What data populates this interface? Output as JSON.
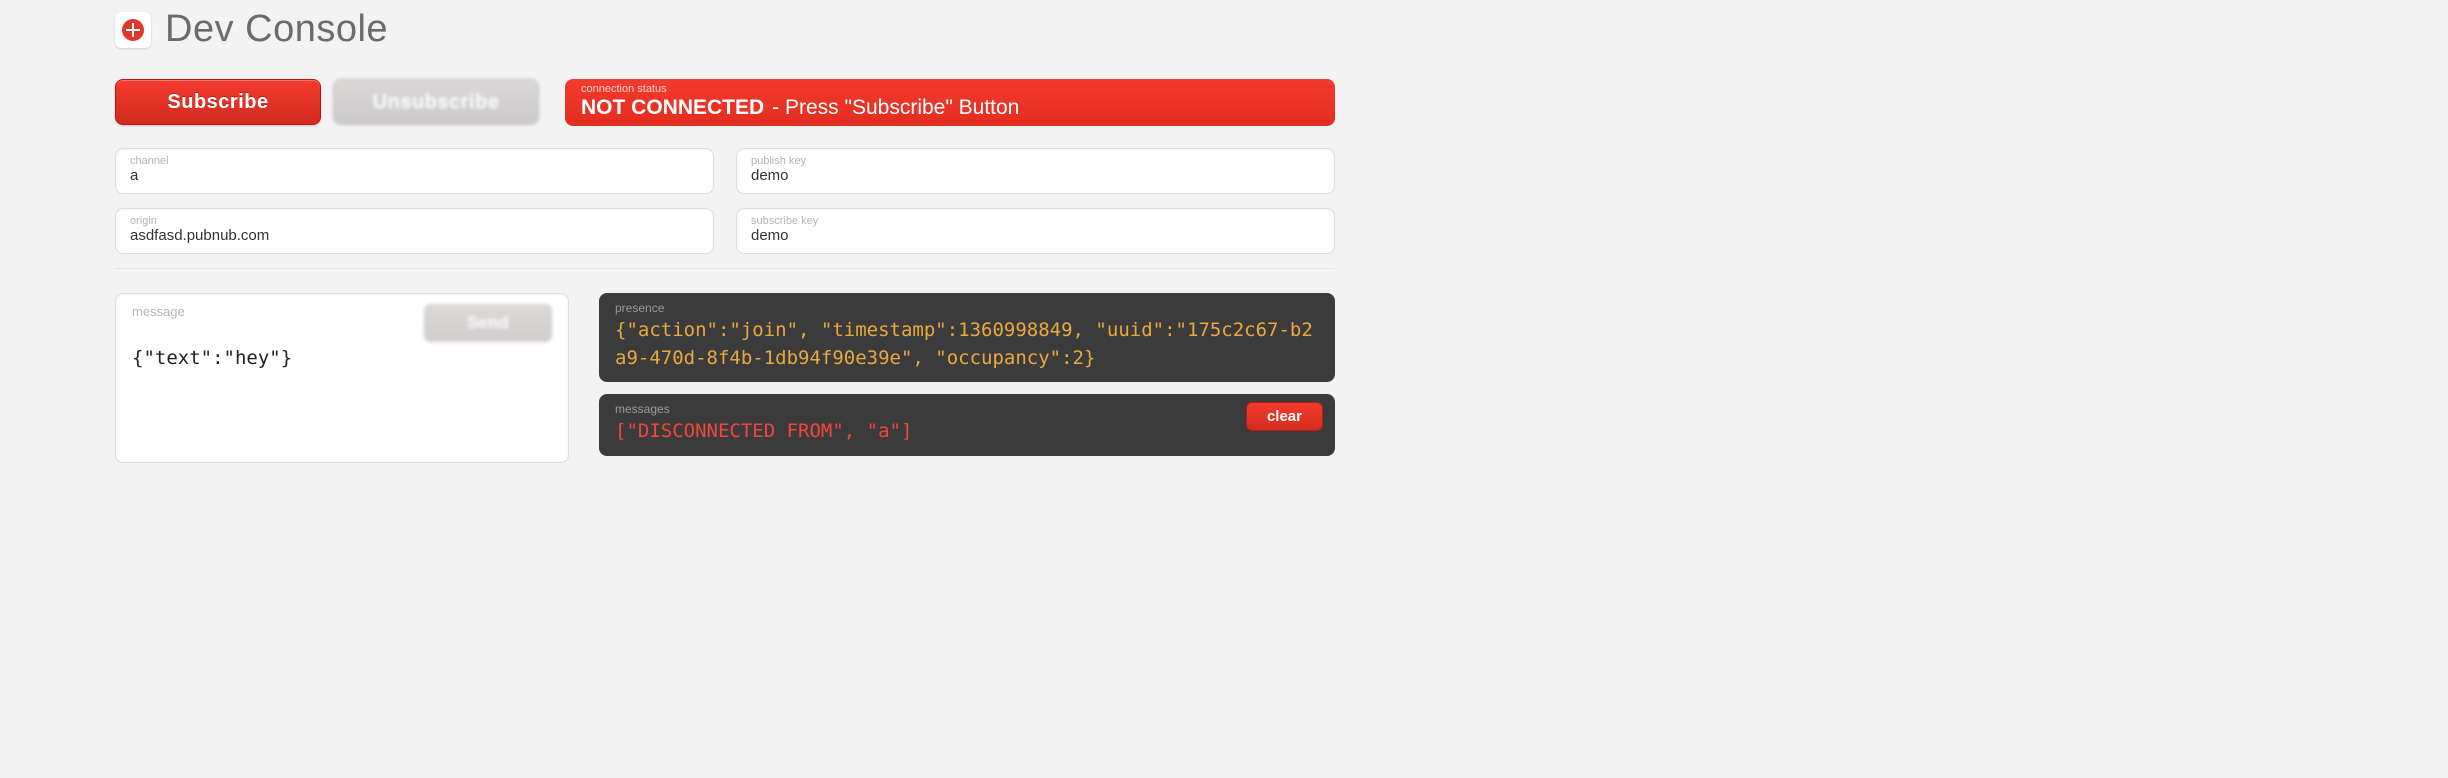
{
  "header": {
    "title": "Dev Console"
  },
  "buttons": {
    "subscribe": "Subscribe",
    "unsubscribe": "Unsubscribe",
    "send": "Send",
    "clear": "clear"
  },
  "status": {
    "label": "connection status",
    "main": "NOT CONNECTED",
    "sub": "- Press \"Subscribe\" Button"
  },
  "inputs": {
    "channel": {
      "label": "channel",
      "value": "a"
    },
    "publish_key": {
      "label": "publish key",
      "value": "demo"
    },
    "origin": {
      "label": "origin",
      "value": "asdfasd.pubnub.com"
    },
    "subscribe_key": {
      "label": "subscribe key",
      "value": "demo"
    }
  },
  "message": {
    "label": "message",
    "value": "{\"text\":\"hey\"}"
  },
  "presence": {
    "label": "presence",
    "content": "{\"action\":\"join\", \"timestamp\":1360998849, \"uuid\":\"175c2c67-b2a9-470d-8f4b-1db94f90e39e\", \"occupancy\":2}"
  },
  "messages": {
    "label": "messages",
    "content": "[\"DISCONNECTED FROM\", \"a\"]"
  }
}
